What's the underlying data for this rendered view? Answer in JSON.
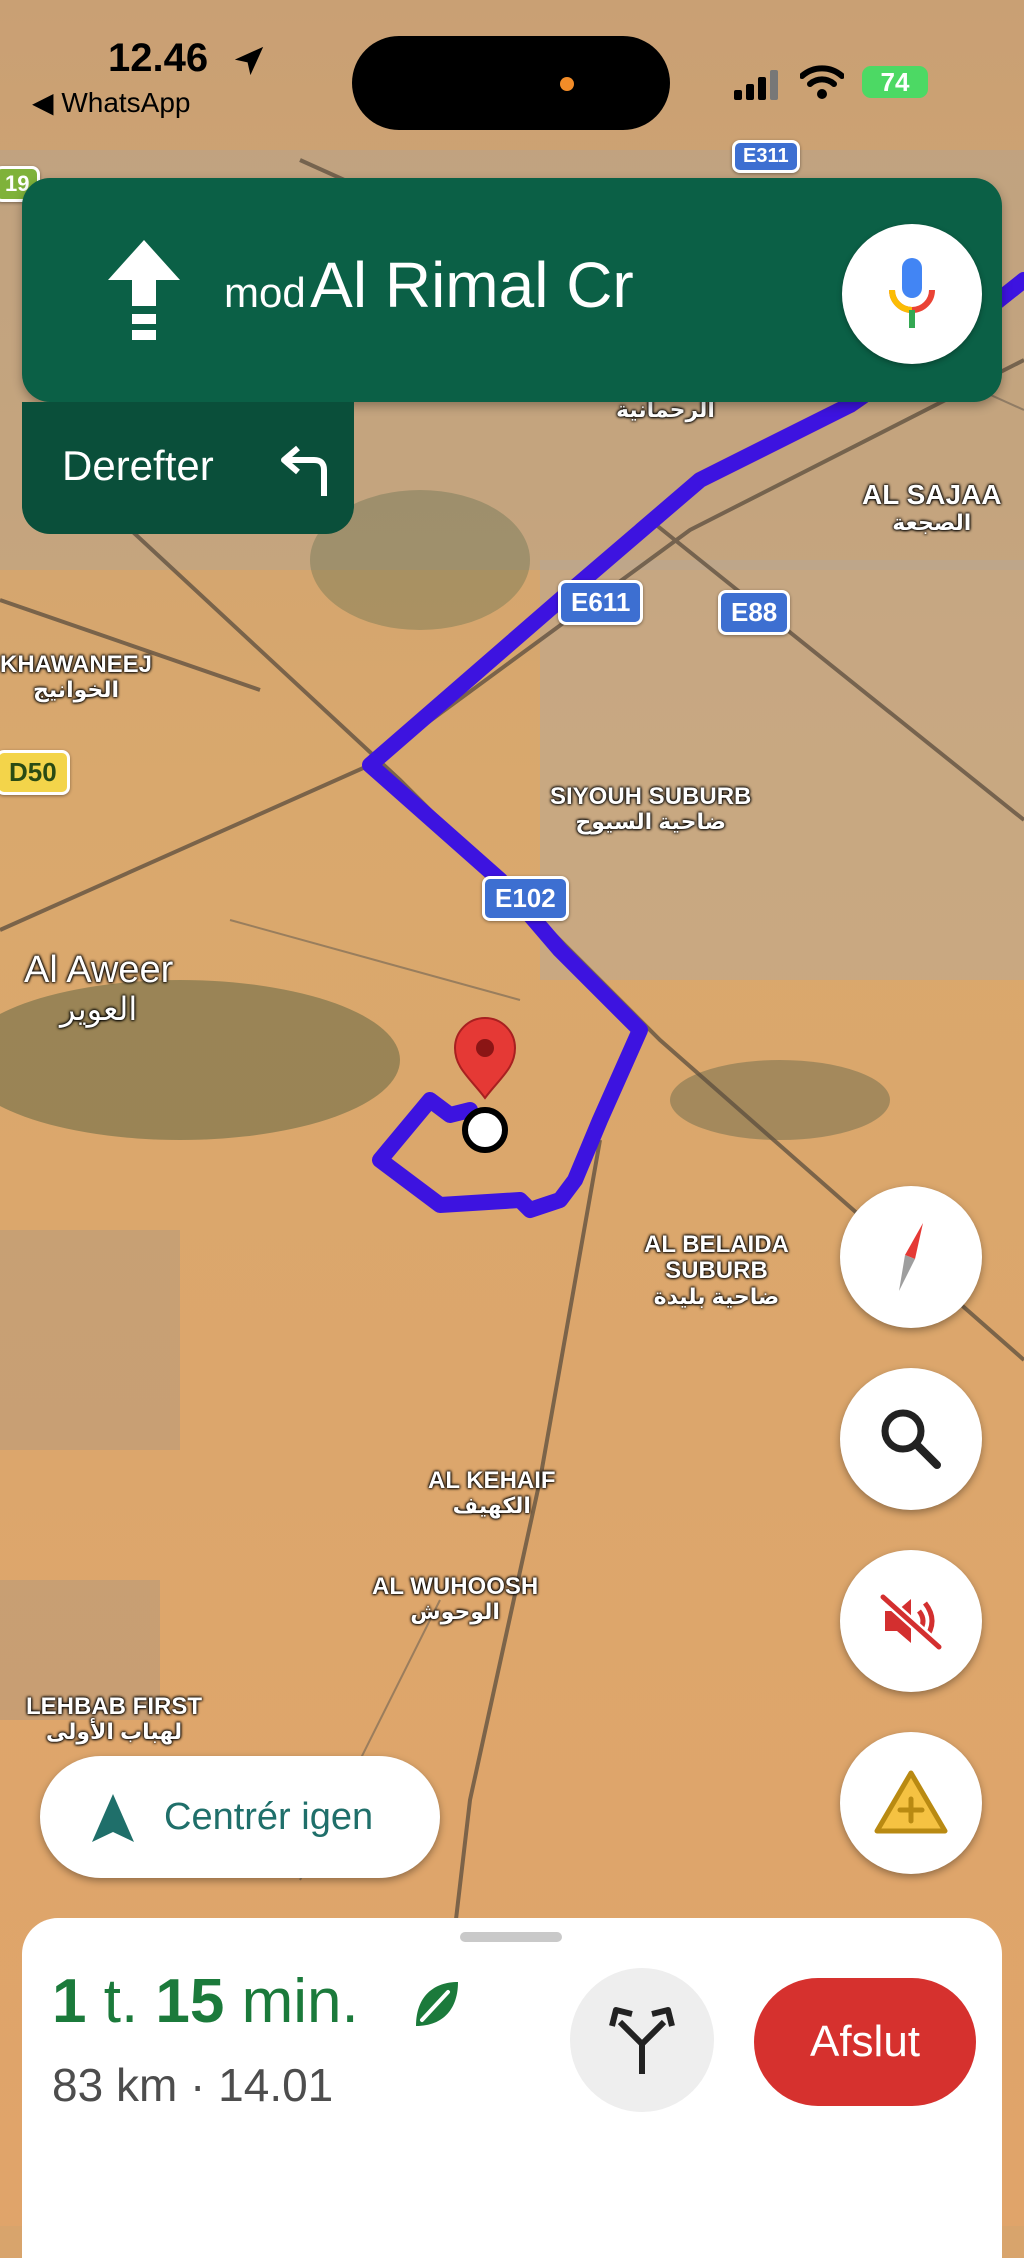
{
  "status_bar": {
    "time": "12.46",
    "back_app": "◀ WhatsApp",
    "battery": "74"
  },
  "nav": {
    "prefix": "mod",
    "street": "Al Rimal Cr",
    "then_label": "Derefter"
  },
  "map": {
    "labels": {
      "al_sajaa": "AL SAJAA",
      "al_sajaa_ar": "الصجعة",
      "khawaneej": "KHAWANEEJ",
      "khawaneej_ar": "الخوانيج",
      "siyouh": "SIYOUH SUBURB",
      "siyouh_ar": "ضاحية السيوح",
      "al_aweer": "Al Aweer",
      "al_aweer_ar": "العوير",
      "al_belaida_1": "AL BELAIDA",
      "al_belaida_2": "SUBURB",
      "al_belaida_ar": "ضاحية بليدة",
      "al_kehaif": "AL KEHAIF",
      "al_kehaif_ar": "الكهيف",
      "al_wuhoosh": "AL WUHOOSH",
      "al_wuhoosh_ar": "الوحوش",
      "lehbab": "LEHBAB FIRST",
      "lehbab_ar": "لهباب الأولى",
      "rahmaniya_ar": "الرحمانية"
    },
    "shields": {
      "e611": "E611",
      "e88": "E88",
      "e102": "E102",
      "d50": "D50",
      "e311": "E311",
      "n19": "19"
    }
  },
  "recenter_label": "Centrér igen",
  "trip": {
    "eta_hours": "1",
    "eta_h_unit": "t.",
    "eta_minutes": "15",
    "eta_m_unit": "min.",
    "distance": "83 km",
    "separator": "·",
    "arrival": "14.01"
  },
  "end_label": "Afslut",
  "colors": {
    "nav_green": "#0b6046",
    "route": "#3d13e0",
    "end_red": "#d6312e",
    "eta_green": "#1b7a3b"
  },
  "icons": {
    "nav_arrow": "straight-arrow-icon",
    "then_turn": "turn-left-icon",
    "mic": "microphone-icon",
    "compass": "compass-icon",
    "search": "search-icon",
    "mute": "sound-muted-icon",
    "report": "report-incident-icon",
    "recenter": "navigation-arrow-icon",
    "eco": "leaf-icon",
    "alternatives": "route-alternatives-icon"
  }
}
